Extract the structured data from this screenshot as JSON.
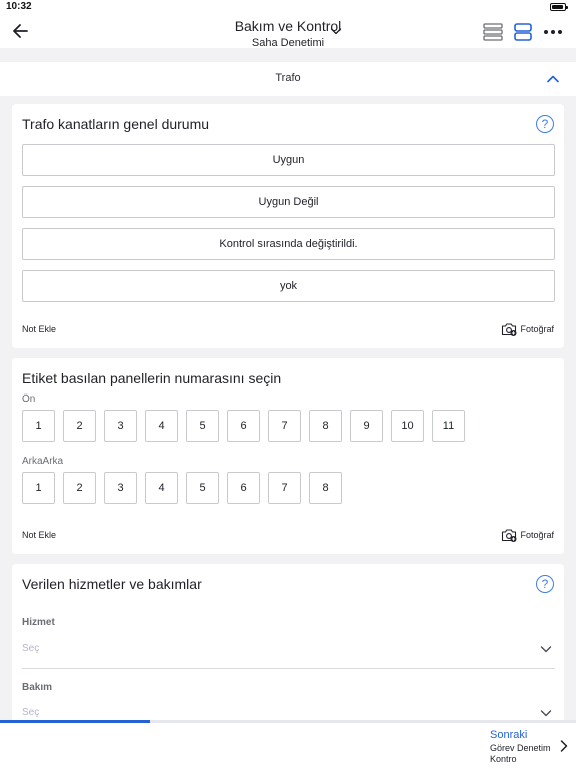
{
  "status_bar": {
    "time": "10:32"
  },
  "header": {
    "title": "Bakım ve Kontrol",
    "subtitle": "Saha Denetimi",
    "icons": [
      "back-arrow-icon",
      "chevron-down-icon",
      "list-view-icon",
      "card-view-icon",
      "more-icon"
    ]
  },
  "section": {
    "title": "Trafo",
    "expanded": true
  },
  "card1": {
    "title": "Trafo kanatların genel durumu",
    "options": [
      "Uygun",
      "Uygun Değil",
      "Kontrol sırasında değiştirildi.",
      "yok"
    ],
    "note_label": "Not Ekle",
    "photo_label": "Fotoğraf"
  },
  "card2": {
    "title": "Etiket basılan panellerin numarasını seçin",
    "rows": [
      {
        "label": "Ön",
        "numbers": [
          "1",
          "2",
          "3",
          "4",
          "5",
          "6",
          "7",
          "8",
          "9",
          "10",
          "11"
        ]
      },
      {
        "label": "ArkaArka",
        "numbers": [
          "1",
          "2",
          "3",
          "4",
          "5",
          "6",
          "7",
          "8"
        ]
      }
    ],
    "note_label": "Not Ekle",
    "photo_label": "Fotoğraf"
  },
  "card3": {
    "title": "Verilen hizmetler ve bakımlar",
    "fields": [
      {
        "label": "Hizmet",
        "value": "Seç"
      },
      {
        "label": "Bakım",
        "value": "Seç"
      }
    ]
  },
  "progress": {
    "fraction": 0.26
  },
  "footer": {
    "next_title": "Sonraki",
    "next_subtitle": "Görev Denetim Kontro"
  },
  "colors": {
    "accent": "#2462d6",
    "help": "#3f7de0",
    "border": "#c9cad0",
    "placeholder": "#b5b7c4"
  }
}
